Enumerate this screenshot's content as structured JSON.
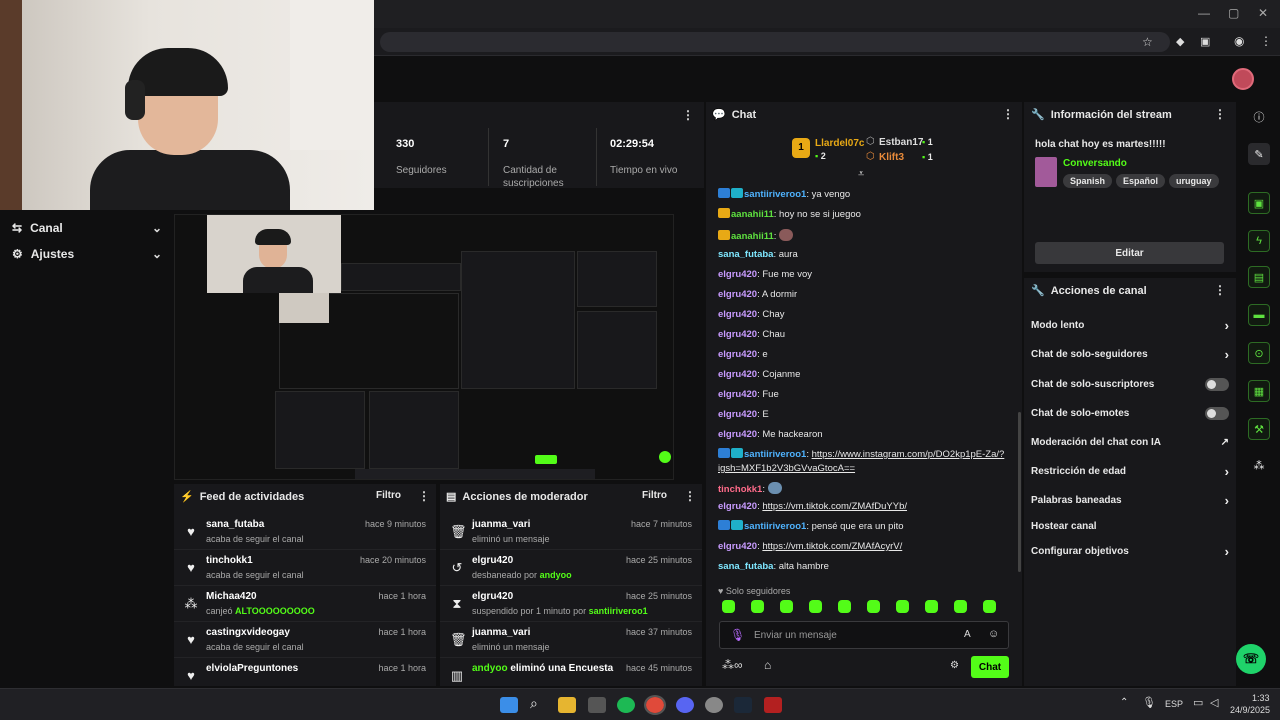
{
  "colors": {
    "accent": "#53fc18",
    "panel": "#18181b",
    "bg": "#0f0f10"
  },
  "nav": {
    "canal": "Canal",
    "ajustes": "Ajustes"
  },
  "stats": [
    {
      "num": "330",
      "label": "Seguidores"
    },
    {
      "num": "7",
      "label": "Cantidad de suscripciones"
    },
    {
      "num": "02:29:54",
      "label": "Tiempo en vivo"
    }
  ],
  "feed": {
    "title": "Feed de actividades",
    "filter": "Filtro",
    "items": [
      {
        "icon": "heart-icon",
        "name": "sana_futaba",
        "sub": "acaba de seguir el canal",
        "time": "hace 9 minutos"
      },
      {
        "icon": "heart-icon",
        "name": "tinchokk1",
        "sub": "acaba de seguir el canal",
        "time": "hace 20 minutos"
      },
      {
        "icon": "points-icon",
        "name": "Michaa420",
        "sub_prefix": "canjeó ",
        "sub_hl": "ALTOOOOOOOOO",
        "time": "hace 1 hora"
      },
      {
        "icon": "heart-icon",
        "name": "castingxvideogay",
        "sub": "acaba de seguir el canal",
        "time": "hace 1 hora"
      },
      {
        "icon": "heart-icon",
        "name": "elviolaPreguntones",
        "sub": "",
        "time": "hace 1 hora"
      }
    ]
  },
  "mod": {
    "title": "Acciones de moderador",
    "filter": "Filtro",
    "items": [
      {
        "icon": "trash-icon",
        "name": "juanma_vari",
        "sub": "eliminó un mensaje",
        "time": "hace 7 minutos"
      },
      {
        "icon": "undo-icon",
        "name": "elgru420",
        "sub_prefix": "desbaneado por ",
        "sub_hl": "andyoo",
        "time": "hace 25 minutos"
      },
      {
        "icon": "hourglass-icon",
        "name": "elgru420",
        "sub_prefix": "suspendido por 1 minuto por ",
        "sub_hl": "santiiriveroo1",
        "time": "hace 25 minutos"
      },
      {
        "icon": "trash-icon",
        "name": "juanma_vari",
        "sub": "eliminó un mensaje",
        "time": "hace 37 minutos"
      },
      {
        "icon": "poll-icon",
        "name_hl": "andyoo",
        "name_rest": " eliminó una Encuesta",
        "time": "hace 45 minutos"
      }
    ]
  },
  "chat": {
    "title": "Chat",
    "top": [
      {
        "rank": "1",
        "name": "Llardel07c",
        "count": "2"
      },
      {
        "name": "Estban17",
        "count": "1"
      },
      {
        "name": "Klift3",
        "count": "1"
      }
    ],
    "messages": [
      {
        "user": "santiiriveroo1",
        "color": "#4fb3ff",
        "text": ": ya vengo"
      },
      {
        "user": "aanahii11",
        "color": "#5ee13f",
        "text": ": hoy no se si juegoo"
      },
      {
        "user": "aanahii11",
        "color": "#5ee13f",
        "text": ":"
      },
      {
        "user": "sana_futaba",
        "color": "#7fe7ff",
        "text": ": aura"
      },
      {
        "user": "elgru420",
        "color": "#c89bff",
        "text": ": Fue me voy"
      },
      {
        "user": "elgru420",
        "color": "#c89bff",
        "text": ": A dormir"
      },
      {
        "user": "elgru420",
        "color": "#c89bff",
        "text": ": Chay"
      },
      {
        "user": "elgru420",
        "color": "#c89bff",
        "text": ": Chau"
      },
      {
        "user": "elgru420",
        "color": "#c89bff",
        "text": ": e"
      },
      {
        "user": "elgru420",
        "color": "#c89bff",
        "text": ": Cojanme"
      },
      {
        "user": "elgru420",
        "color": "#c89bff",
        "text": ": Fue"
      },
      {
        "user": "elgru420",
        "color": "#c89bff",
        "text": ": E"
      },
      {
        "user": "elgru420",
        "color": "#c89bff",
        "text": ": Me hackearon"
      }
    ],
    "msg_insta_user": "santiiriveroo1",
    "msg_insta_link": "https://www.instagram.com/p/DO2kp1pE-Za/?igsh=MXF1b2V3bGVvaGtocA==",
    "msg_tincho_user": "tinchokk1",
    "msg_tiktok1_user": "elgru420",
    "msg_tiktok1_link": "https://vm.tiktok.com/ZMAfDuYYb/",
    "msg_pito_user": "santiiriveroo1",
    "msg_pito_text": ": pensé que era un pito",
    "msg_tiktok2_user": "elgru420",
    "msg_tiktok2_link": "https://vm.tiktok.com/ZMAfAcyrV/",
    "msg_hambre_user": "sana_futaba",
    "msg_hambre_text": ": alta hambre",
    "followers_only": "Solo seguidores",
    "input_placeholder": "Enviar un mensaje",
    "send": "Chat"
  },
  "info": {
    "title": "Información del stream",
    "stream_title": "hola chat hoy es martes!!!!!",
    "category": "Conversando",
    "tags": [
      "Spanish",
      "Español",
      "uruguay"
    ],
    "edit": "Editar"
  },
  "actions": {
    "title": "Acciones de canal",
    "items": [
      {
        "label": "Modo lento",
        "ctrl": "chevron"
      },
      {
        "label": "Chat de solo-seguidores",
        "ctrl": "chevron"
      },
      {
        "label": "Chat de solo-suscriptores",
        "ctrl": "toggle"
      },
      {
        "label": "Chat de solo-emotes",
        "ctrl": "toggle"
      },
      {
        "label": "Moderación del chat con IA",
        "ctrl": "external"
      },
      {
        "label": "Restricción de edad",
        "ctrl": "chevron"
      },
      {
        "label": "Palabras baneadas",
        "ctrl": "chevron"
      },
      {
        "label": "Hostear canal",
        "ctrl": "none"
      },
      {
        "label": "Configurar objetivos",
        "ctrl": "chevron"
      }
    ]
  },
  "taskbar": {
    "lang": "ESP",
    "time": "1:33",
    "date": "24/9/2025"
  }
}
